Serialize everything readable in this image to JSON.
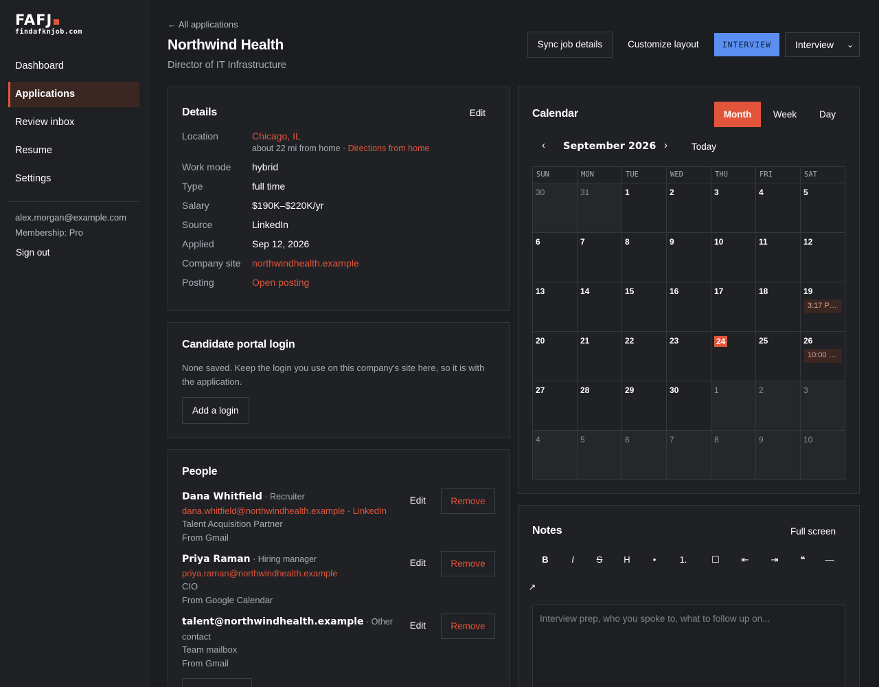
{
  "brand": {
    "logo": "FAFJ",
    "domain": "findafknjob.com",
    "accent": "#e2553a"
  },
  "sidebar": {
    "items": [
      {
        "label": "Dashboard"
      },
      {
        "label": "Applications"
      },
      {
        "label": "Review inbox"
      },
      {
        "label": "Resume"
      },
      {
        "label": "Settings"
      }
    ],
    "email": "alex.morgan@example.com",
    "membership": "Membership: Pro",
    "signout": "Sign out"
  },
  "header": {
    "back": "← All applications",
    "company": "Northwind Health",
    "role": "Director of IT Infrastructure",
    "sync_label": "Sync job details",
    "customize_label": "Customize layout",
    "status_badge": "INTERVIEW",
    "status_select": "Interview"
  },
  "details": {
    "title": "Details",
    "edit": "Edit",
    "location_label": "Location",
    "location_value": "Chicago, IL",
    "distance": "about 22 mi from home · ",
    "directions": "Directions from home",
    "work_mode_label": "Work mode",
    "work_mode_value": "hybrid",
    "type_label": "Type",
    "type_value": "full time",
    "salary_label": "Salary",
    "salary_value": "$190K–$220K/yr",
    "source_label": "Source",
    "source_value": "LinkedIn",
    "applied_label": "Applied",
    "applied_value": "Sep 12, 2026",
    "site_label": "Company site",
    "site_value": "northwindhealth.example",
    "posting_label": "Posting",
    "posting_value": "Open posting"
  },
  "portal": {
    "title": "Candidate portal login",
    "text": "None saved. Keep the login you use on this company's site here, so it is with the application.",
    "add": "Add a login"
  },
  "people": {
    "title": "People",
    "edit": "Edit",
    "remove": "Remove",
    "list": [
      {
        "name": "Dana Whitfield",
        "role": " · Recruiter",
        "email": "dana.whitfield@northwindhealth.example",
        "sep": " · ",
        "link": "LinkedIn",
        "title": "Talent Acquisition Partner",
        "from": "From Gmail"
      },
      {
        "name": "Priya Raman",
        "role": " · Hiring manager",
        "email": "priya.raman@northwindhealth.example",
        "title": "CIO",
        "from": "From Google Calendar"
      },
      {
        "name": "talent@northwindhealth.example",
        "role": " · Other",
        "role2": "contact",
        "title": "Team mailbox",
        "from": "From Gmail"
      }
    ]
  },
  "calendar": {
    "title": "Calendar",
    "views": [
      "Month",
      "Week",
      "Day"
    ],
    "prev": "‹",
    "next": "›",
    "month": "September 2026",
    "today": "Today",
    "weekdays": [
      "SUN",
      "MON",
      "TUE",
      "WED",
      "THU",
      "FRI",
      "SAT"
    ],
    "weeks": [
      [
        "30",
        "31",
        "1",
        "2",
        "3",
        "4",
        "5"
      ],
      [
        "6",
        "7",
        "8",
        "9",
        "10",
        "11",
        "12"
      ],
      [
        "13",
        "14",
        "15",
        "16",
        "17",
        "18",
        "19"
      ],
      [
        "20",
        "21",
        "22",
        "23",
        "24",
        "25",
        "26"
      ],
      [
        "27",
        "28",
        "29",
        "30",
        "1",
        "2",
        "3"
      ],
      [
        "4",
        "5",
        "6",
        "7",
        "8",
        "9",
        "10"
      ]
    ],
    "events": {
      "19": "3:17 P…",
      "26": "10:00 …"
    },
    "today_day": "24"
  },
  "notes": {
    "title": "Notes",
    "fullscreen": "Full screen",
    "toolbar": [
      {
        "glyph": "B",
        "icon": "bold-icon"
      },
      {
        "glyph": "I",
        "icon": "italic-icon"
      },
      {
        "glyph": "S",
        "icon": "strikethrough-icon"
      },
      {
        "glyph": "H",
        "icon": "heading-icon"
      },
      {
        "glyph": "•",
        "icon": "bullet-list-icon"
      },
      {
        "glyph": "1.",
        "icon": "numbered-list-icon"
      },
      {
        "glyph": "☐",
        "icon": "checkbox-icon"
      },
      {
        "glyph": "⇤",
        "icon": "outdent-icon"
      },
      {
        "glyph": "⇥",
        "icon": "indent-icon"
      },
      {
        "glyph": "❝",
        "icon": "quote-icon"
      },
      {
        "glyph": "—",
        "icon": "divider-icon"
      },
      {
        "glyph": "↗",
        "icon": "link-icon"
      }
    ],
    "placeholder": "Interview prep, who you spoke to, what to follow up on..."
  }
}
